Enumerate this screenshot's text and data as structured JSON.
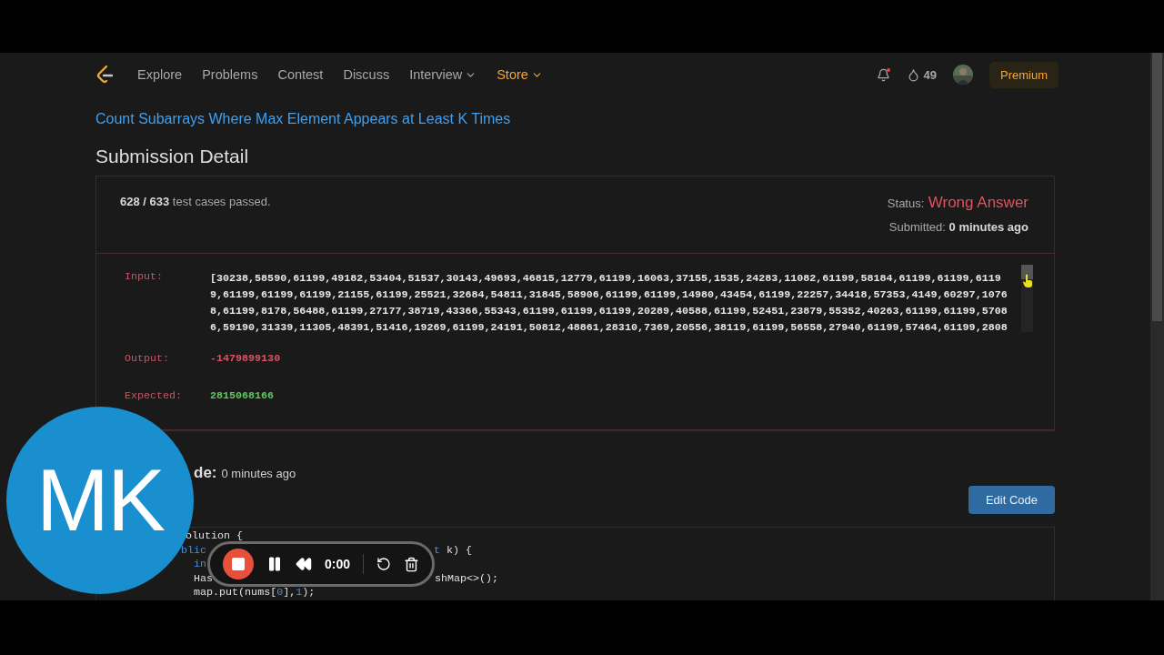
{
  "nav": {
    "items": [
      {
        "label": "Explore",
        "dropdown": false,
        "highlight": false
      },
      {
        "label": "Problems",
        "dropdown": false,
        "highlight": false
      },
      {
        "label": "Contest",
        "dropdown": false,
        "highlight": false
      },
      {
        "label": "Discuss",
        "dropdown": false,
        "highlight": false
      },
      {
        "label": "Interview",
        "dropdown": true,
        "highlight": false
      },
      {
        "label": "Store",
        "dropdown": true,
        "highlight": true
      }
    ],
    "notification_dot": true,
    "streak": "49",
    "premium": "Premium"
  },
  "problem_title": "Count Subarrays Where Max Element Appears at Least K Times",
  "heading": "Submission Detail",
  "summary": {
    "passed": "628 / 633",
    "passed_suffix": "test cases passed.",
    "status_label": "Status:",
    "status": "Wrong Answer",
    "submitted_label": "Submitted:",
    "submitted": "0 minutes ago"
  },
  "result": {
    "input_label": "Input:",
    "input_lines": [
      "[30238,58590,61199,49182,53404,51537,30143,49693,46815,12779,61199,16063,37155,1535,24283,11082,61199,58184,61199,61199,6119",
      "9,61199,61199,61199,21155,61199,25521,32684,54811,31845,58906,61199,61199,14980,43454,61199,22257,34418,57353,4149,60297,1076",
      "8,61199,8178,56488,61199,27177,38719,43366,55343,61199,61199,61199,20289,40588,61199,52451,23879,55352,40263,61199,61199,5708",
      "6,59190,31339,11305,48391,51416,19269,61199,24191,50812,48861,28310,7369,20556,38119,61199,56558,27940,61199,57464,61199,2808"
    ],
    "output_label": "Output:",
    "output": "-1479899130",
    "expected_label": "Expected:",
    "expected": "2815068166"
  },
  "code_section": {
    "title": "de:",
    "time": "0 minutes ago",
    "edit_button": "Edit Code"
  },
  "code_lines": [
    [
      [
        {
          "kind": "plain",
          "text": "olution {"
        }
      ]
    ],
    [
      [
        {
          "kind": "keyword",
          "text": "blic"
        }
      ],
      [
        {
          "kind": "keyword",
          "text": "t"
        },
        {
          "kind": "plain",
          "text": " k) {"
        }
      ]
    ],
    [
      [
        {
          "kind": "keyword",
          "text": "in"
        }
      ]
    ],
    [
      [
        {
          "kind": "plain",
          "text": "Has"
        }
      ],
      [
        {
          "kind": "plain",
          "text": "shMap<>();"
        }
      ]
    ],
    [
      [
        {
          "kind": "plain",
          "text": "map.put(nums["
        },
        {
          "kind": "number",
          "text": "0"
        },
        {
          "kind": "plain",
          "text": "],"
        },
        {
          "kind": "number",
          "text": "1"
        },
        {
          "kind": "plain",
          "text": ");"
        }
      ]
    ]
  ],
  "webcam": {
    "initials": "MK"
  },
  "recorder": {
    "time": "0:00"
  }
}
